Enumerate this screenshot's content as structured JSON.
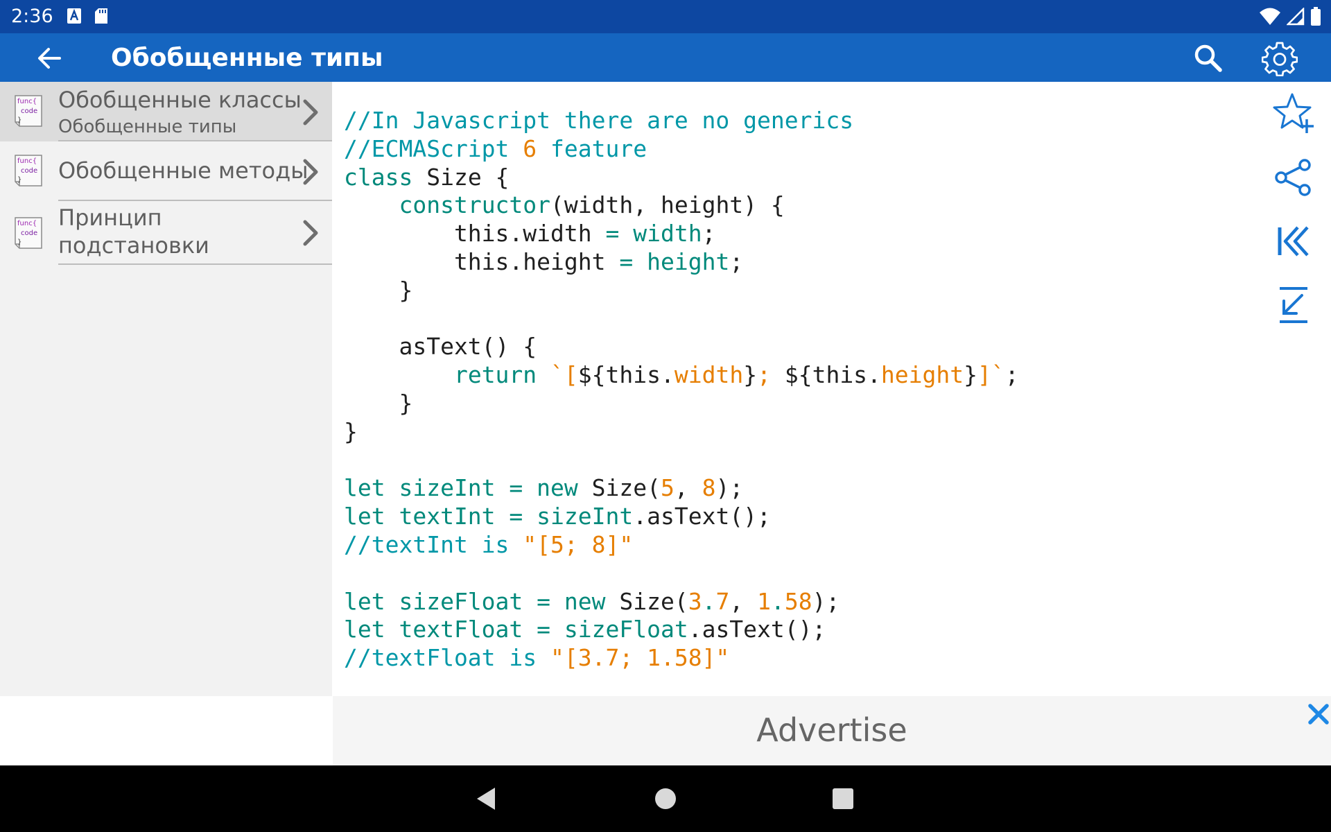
{
  "status_bar": {
    "time": "2:36"
  },
  "app_bar": {
    "title": "Обобщенные типы"
  },
  "sidebar": {
    "items": [
      {
        "label": "Обобщенные классы",
        "sublabel": "Обобщенные типы",
        "icon_text": [
          "func{",
          "code",
          "}"
        ]
      },
      {
        "label": "Обобщенные методы",
        "icon_text": [
          "func{",
          "code",
          "}"
        ]
      },
      {
        "label": "Принцип",
        "label2": "подстановки",
        "icon_text": [
          "func{",
          "code",
          "}"
        ]
      }
    ]
  },
  "code": {
    "lines": [
      [
        [
          "c-com",
          "//In Javascript there are no generics"
        ]
      ],
      [
        [
          "c-com",
          "//ECMAScript "
        ],
        [
          "c-num",
          "6"
        ],
        [
          "c-com",
          " feature"
        ]
      ],
      [
        [
          "c-kw",
          "class"
        ],
        [
          "c-plain",
          " Size {"
        ]
      ],
      [
        [
          "c-plain",
          "    "
        ],
        [
          "c-kw",
          "constructor"
        ],
        [
          "c-plain",
          "(width, height) {"
        ]
      ],
      [
        [
          "c-plain",
          "        this.width "
        ],
        [
          "c-kw",
          "="
        ],
        [
          "c-plain",
          " "
        ],
        [
          "c-kw",
          "width"
        ],
        [
          "c-plain",
          ";"
        ]
      ],
      [
        [
          "c-plain",
          "        this.height "
        ],
        [
          "c-kw",
          "="
        ],
        [
          "c-plain",
          " "
        ],
        [
          "c-kw",
          "height"
        ],
        [
          "c-plain",
          ";"
        ]
      ],
      [
        [
          "c-plain",
          "    }"
        ]
      ],
      [
        [
          "c-plain",
          ""
        ]
      ],
      [
        [
          "c-plain",
          "    asText() {"
        ]
      ],
      [
        [
          "c-plain",
          "        "
        ],
        [
          "c-kw",
          "return"
        ],
        [
          "c-plain",
          " "
        ],
        [
          "c-str",
          "`["
        ],
        [
          "c-plain",
          "${this."
        ],
        [
          "c-str",
          "width"
        ],
        [
          "c-plain",
          "}"
        ],
        [
          "c-str",
          "; "
        ],
        [
          "c-plain",
          "${this."
        ],
        [
          "c-str",
          "height"
        ],
        [
          "c-plain",
          "}"
        ],
        [
          "c-str",
          "]`"
        ],
        [
          "c-plain",
          ";"
        ]
      ],
      [
        [
          "c-plain",
          "    }"
        ]
      ],
      [
        [
          "c-plain",
          "}"
        ]
      ],
      [
        [
          "c-plain",
          ""
        ]
      ],
      [
        [
          "c-kw",
          "let sizeInt = new"
        ],
        [
          "c-plain",
          " Size("
        ],
        [
          "c-num",
          "5"
        ],
        [
          "c-plain",
          ", "
        ],
        [
          "c-num",
          "8"
        ],
        [
          "c-plain",
          ");"
        ]
      ],
      [
        [
          "c-kw",
          "let textInt = sizeInt"
        ],
        [
          "c-plain",
          ".asText();"
        ]
      ],
      [
        [
          "c-com",
          "//textInt is "
        ],
        [
          "c-str",
          "\"[5; 8]\""
        ]
      ],
      [
        [
          "c-plain",
          ""
        ]
      ],
      [
        [
          "c-kw",
          "let sizeFloat = new"
        ],
        [
          "c-plain",
          " Size("
        ],
        [
          "c-num",
          "3"
        ],
        [
          "c-kw",
          "."
        ],
        [
          "c-num",
          "7"
        ],
        [
          "c-plain",
          ", "
        ],
        [
          "c-num",
          "1"
        ],
        [
          "c-kw",
          "."
        ],
        [
          "c-num",
          "58"
        ],
        [
          "c-plain",
          ");"
        ]
      ],
      [
        [
          "c-kw",
          "let textFloat = sizeFloat"
        ],
        [
          "c-plain",
          ".asText();"
        ]
      ],
      [
        [
          "c-com",
          "//textFloat is "
        ],
        [
          "c-str",
          "\"[3.7; 1.58]\""
        ]
      ]
    ]
  },
  "ad": {
    "text": "Advertise"
  },
  "colors": {
    "status": "#0d47a1",
    "appbar": "#1565c0",
    "accent": "#1976d2"
  }
}
